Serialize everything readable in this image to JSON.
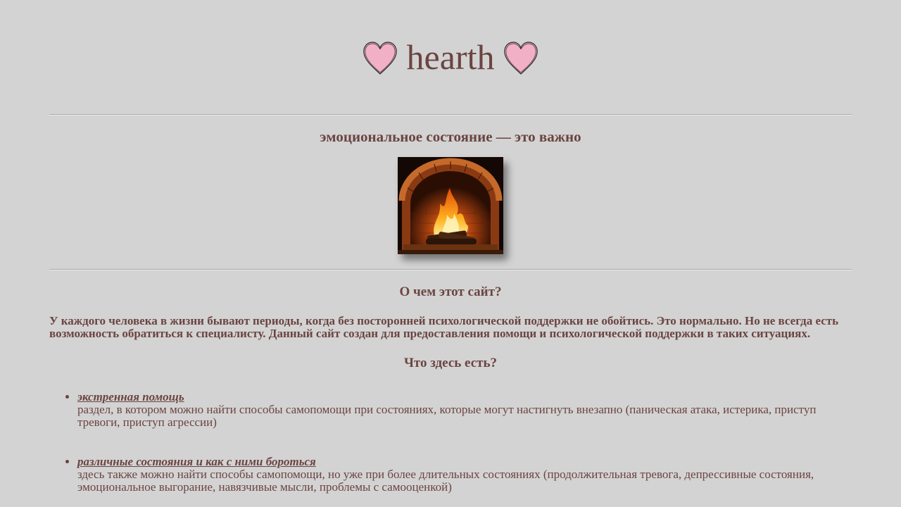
{
  "header": {
    "title": "hearth",
    "left_icon": "heart-icon",
    "right_icon": "heart-icon",
    "heart_color": "#f2b0c6"
  },
  "hero": {
    "heading": "эмоциональное состояние — это важно",
    "image_icon": "fireplace-image"
  },
  "about": {
    "heading": "О чем этот сайт?",
    "text": "У каждого человека в жизни бывают периоды, когда без посторонней психологической поддержки не обойтись. Это нормально. Но не всегда есть возможность обратиться к специалисту. Данный сайт создан для предоставления помощи и психологической поддержки в таких ситуациях."
  },
  "features": {
    "heading": "Что здесь есть?",
    "items": [
      {
        "label": "экстренная помощь",
        "description": "раздел, в котором можно найти способы самопомощи при состояниях, которые могут настигнуть внезапно (паническая атака, истерика, приступ тревоги, приступ агрессии)"
      },
      {
        "label": "различные состояния и как с ними бороться",
        "description": "здесь также можно найти способы самопомощи, но уже при более длительных состояниях (продолжительная тревога, депрессивные состояния, эмоциональное выгорание, навязчивые мысли, проблемы с самооценкой)"
      }
    ]
  },
  "colors": {
    "background": "#d3d3d3",
    "text": "#6b4441"
  }
}
